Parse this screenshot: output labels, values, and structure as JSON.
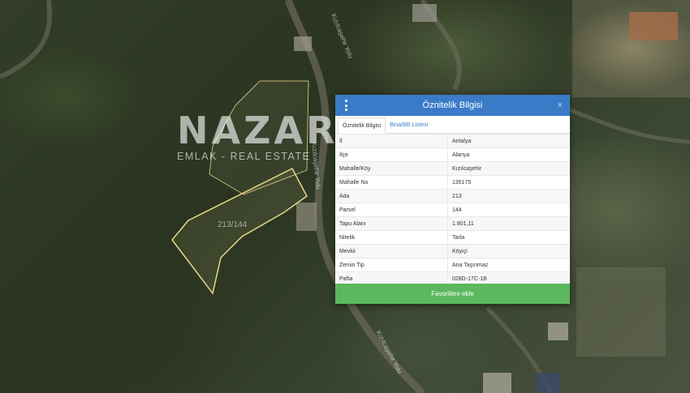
{
  "panel": {
    "title": "Öznitelik Bilgisi",
    "close": "×",
    "tabs": [
      {
        "label": "Öznitelik Bilgisi",
        "active": true
      },
      {
        "label": "Bina/BB Listesi",
        "active": false
      }
    ],
    "rows": [
      {
        "key": "İl",
        "value": "Antalya"
      },
      {
        "key": "İlçe",
        "value": "Alanya"
      },
      {
        "key": "Mahalle/Köy",
        "value": "Kızılcaşehir"
      },
      {
        "key": "Mahalle No",
        "value": "135175"
      },
      {
        "key": "Ada",
        "value": "213"
      },
      {
        "key": "Parsel",
        "value": "144"
      },
      {
        "key": "Tapu Alanı",
        "value": "1.801,11"
      },
      {
        "key": "Nitelik",
        "value": "Tarla"
      },
      {
        "key": "Mevkii",
        "value": "Köyiçi"
      },
      {
        "key": "Zemin Tip",
        "value": "Ana Taşınmaz"
      },
      {
        "key": "Pafta",
        "value": "028D-17C-1B"
      }
    ],
    "favorite_button": "Favorilere ekle"
  },
  "watermark": {
    "logo": "NAZAR",
    "subtitle": "EMLAK - REAL ESTATE"
  },
  "map": {
    "parcel_label": "213/144",
    "road_labels": [
      "Kızılcaşehir Yolu",
      "Kızılcaşehir Yolu",
      "Kızılcaşehir Yolu"
    ]
  },
  "colors": {
    "header": "#3a7bc8",
    "favorite_button": "#5cb85c",
    "parcel_outline": "#e8d78a"
  },
  "icons": [
    "menu-icon",
    "close-icon"
  ]
}
